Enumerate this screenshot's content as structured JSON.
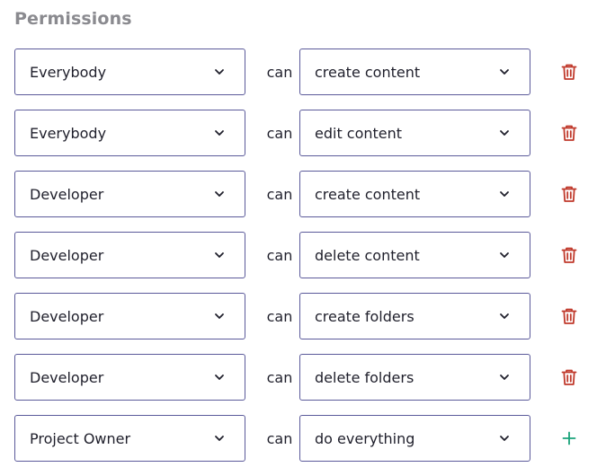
{
  "title": "Permissions",
  "can_label": "can",
  "colors": {
    "border": "#5b5a9a",
    "title": "#8a8a8f",
    "delete": "#c0392b",
    "add": "#1aa37a"
  },
  "rows": [
    {
      "role": "Everybody",
      "permission": "create content",
      "action_icon": "trash-icon"
    },
    {
      "role": "Everybody",
      "permission": "edit content",
      "action_icon": "trash-icon"
    },
    {
      "role": "Developer",
      "permission": "create content",
      "action_icon": "trash-icon"
    },
    {
      "role": "Developer",
      "permission": "delete content",
      "action_icon": "trash-icon"
    },
    {
      "role": "Developer",
      "permission": "create folders",
      "action_icon": "trash-icon"
    },
    {
      "role": "Developer",
      "permission": "delete folders",
      "action_icon": "trash-icon"
    },
    {
      "role": "Project Owner",
      "permission": "do everything",
      "action_icon": "plus-icon"
    }
  ]
}
